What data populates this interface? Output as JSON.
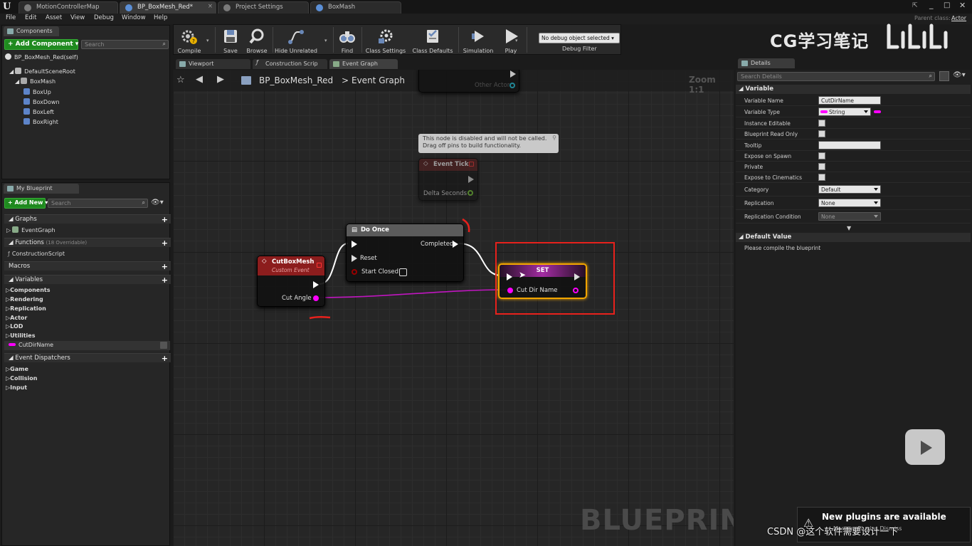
{
  "doc_tabs": [
    "MotionControllerMap",
    "BP_BoxMesh_Red*",
    "Project Settings",
    "BoxMash"
  ],
  "title_right": {
    "parent_class_label": "Parent class:",
    "parent_class_value": "Actor"
  },
  "menu": [
    "File",
    "Edit",
    "Asset",
    "View",
    "Debug",
    "Window",
    "Help"
  ],
  "components_panel": {
    "tab_label": "Components",
    "add_button": "+ Add Component ▾",
    "search_placeholder": "Search",
    "self_item": "BP_BoxMesh_Red(self)",
    "tree": [
      "DefaultSceneRoot",
      "BoxMash",
      "BoxUp",
      "BoxDown",
      "BoxLeft",
      "BoxRight"
    ]
  },
  "my_blueprint": {
    "tab_label": "My Blueprint",
    "add_button": "+ Add New ▾",
    "search_placeholder": "Search",
    "graphs_header": "Graphs",
    "graph_item": "EventGraph",
    "functions_header": "Functions",
    "functions_note": "(18 Overridable)",
    "function_item": "ConstructionScript",
    "macros_header": "Macros",
    "variables_header": "Variables",
    "variable_categories": [
      "Components",
      "Rendering",
      "Replication",
      "Actor",
      "LOD",
      "Utilities"
    ],
    "variable_item": "CutDirName",
    "dispatchers_header": "Event Dispatchers",
    "dispatcher_categories": [
      "Game",
      "Collision",
      "Input"
    ]
  },
  "toolbar": {
    "compile": "Compile",
    "save": "Save",
    "browse": "Browse",
    "hide_unrelated": "Hide Unrelated",
    "find": "Find",
    "class_settings": "Class Settings",
    "class_defaults": "Class Defaults",
    "simulation": "Simulation",
    "play": "Play",
    "debug_object": "No debug object selected ▾",
    "debug_filter": "Debug Filter"
  },
  "watermark_top": "CG学习笔记",
  "graph_tabs": [
    "Viewport",
    "Construction Scrip",
    "Event Graph"
  ],
  "graph": {
    "breadcrumb_root": "BP_BoxMesh_Red",
    "breadcrumb_sep": ">",
    "breadcrumb_leaf": "Event Graph",
    "zoom": "Zoom 1:1",
    "other_actor": "Other Actor",
    "disabled_tooltip_line1": "This node is disabled and will not be called.",
    "disabled_tooltip_line2": "Drag off pins to build functionality.",
    "event_tick": {
      "title": "Event Tick",
      "pin": "Delta Seconds"
    },
    "custom_event": {
      "title": "CutBoxMesh",
      "subtitle": "Custom Event",
      "pin": "Cut Angle"
    },
    "do_once": {
      "title": "Do Once",
      "reset": "Reset",
      "start_closed": "Start Closed",
      "completed": "Completed"
    },
    "set_node": {
      "title": "SET",
      "pin": "Cut Dir Name"
    },
    "watermark": "BLUEPRINT"
  },
  "details": {
    "tab_label": "Details",
    "search_placeholder": "Search Details",
    "variable_section": "Variable",
    "rows": [
      {
        "label": "Variable Name",
        "value": "CutDirName",
        "kind": "text"
      },
      {
        "label": "Variable Type",
        "value": "String",
        "kind": "type"
      },
      {
        "label": "Instance Editable",
        "kind": "check"
      },
      {
        "label": "Blueprint Read Only",
        "kind": "check"
      },
      {
        "label": "Tooltip",
        "value": "",
        "kind": "text"
      },
      {
        "label": "Expose on Spawn",
        "kind": "check"
      },
      {
        "label": "Private",
        "kind": "check"
      },
      {
        "label": "Expose to Cinematics",
        "kind": "check"
      },
      {
        "label": "Category",
        "value": "Default",
        "kind": "drop"
      },
      {
        "label": "Replication",
        "value": "None",
        "kind": "drop"
      },
      {
        "label": "Replication Condition",
        "value": "None",
        "kind": "drop"
      }
    ],
    "default_section": "Default Value",
    "default_note": "Please compile the blueprint"
  },
  "notification": {
    "title": "New plugins are available",
    "sub": "Manage Plugins   Dismiss"
  },
  "footer_watermark": "CSDN @这个软件需要设计一下",
  "colors": {
    "accent_green": "#1f8a1f",
    "string_pin": "#ff00ff",
    "highlight": "#e8211c",
    "set_outline": "#f2a500",
    "event_red": "#8c1d1d"
  }
}
